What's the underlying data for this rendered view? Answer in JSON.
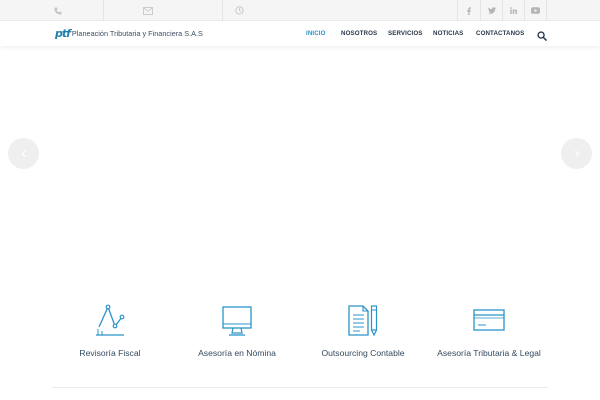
{
  "brand": {
    "logo_mark": "ptf",
    "name": "Planeación Tributaria y Financiera S.A.S"
  },
  "topbar": {
    "phone_icon": "phone-icon",
    "email_icon": "envelope-icon",
    "hours_icon": "clock-icon",
    "social": [
      "facebook-icon",
      "twitter-icon",
      "linkedin-icon",
      "youtube-icon"
    ]
  },
  "nav": {
    "items": [
      {
        "label": "INICIO",
        "active": true
      },
      {
        "label": "NOSOTROS",
        "active": false
      },
      {
        "label": "SERVICIOS",
        "active": false
      },
      {
        "label": "NOTICIAS",
        "active": false
      },
      {
        "label": "CONTACTANOS",
        "active": false
      }
    ],
    "search_icon": "search-icon"
  },
  "slider": {
    "prev_icon": "chevron-left-icon",
    "next_icon": "chevron-right-icon"
  },
  "services": [
    {
      "label": "Revisoría Fiscal",
      "icon": "line-chart-icon"
    },
    {
      "label": "Asesoría en Nómina",
      "icon": "monitor-icon"
    },
    {
      "label": "Outsourcing Contable",
      "icon": "document-pen-icon"
    },
    {
      "label": "Asesoría Tributaria & Legal",
      "icon": "credit-card-icon"
    }
  ],
  "colors": {
    "accent": "#2a94c8",
    "nav_text": "#26374a",
    "icon_stroke": "#2a94c8",
    "topbar_bg": "#f5f5f5"
  }
}
